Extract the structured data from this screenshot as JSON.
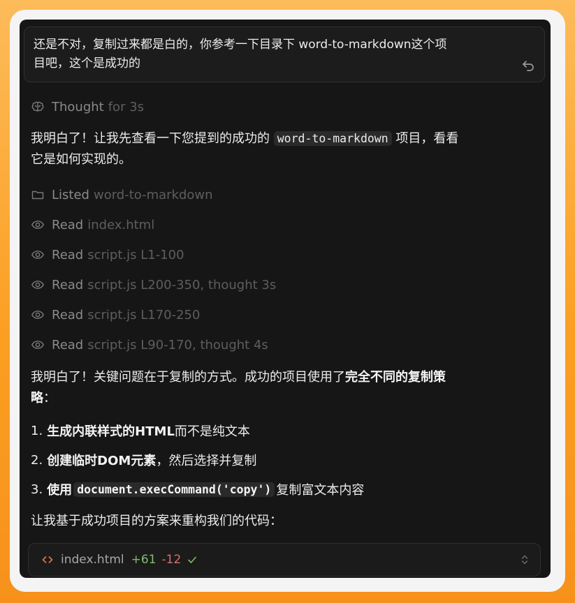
{
  "user_message": {
    "line1": "还是不对，复制过来都是白的，你参考一下目录下 word-to-markdown这个项",
    "line2": "目吧，这个是成功的"
  },
  "thought": {
    "label": "Thought",
    "duration": "for 3s"
  },
  "intro": {
    "before": "我明白了！让我先查看一下您提到的成功的 ",
    "code": "word-to-markdown",
    "after": " 项目，看看",
    "line2": "它是如何实现的。"
  },
  "tool_calls": [
    {
      "verb": "Listed",
      "target": "word-to-markdown",
      "icon": "folder-icon"
    },
    {
      "verb": "Read",
      "target": "index.html",
      "icon": "eye-icon"
    },
    {
      "verb": "Read",
      "target": "script.js L1-100",
      "icon": "eye-icon"
    },
    {
      "verb": "Read",
      "target": "script.js L200-350, thought 3s",
      "icon": "eye-icon"
    },
    {
      "verb": "Read",
      "target": "script.js L170-250",
      "icon": "eye-icon"
    },
    {
      "verb": "Read",
      "target": "script.js L90-170, thought 4s",
      "icon": "eye-icon"
    }
  ],
  "analysis": {
    "text": "我明白了！关键问题在于复制的方式。成功的项目使用了",
    "bold": "完全不同的复制策",
    "bold2": "略",
    "tail": "："
  },
  "steps": [
    {
      "num": "1.",
      "bold": "生成内联样式的HTML",
      "rest": "而不是纯文本"
    },
    {
      "num": "2.",
      "bold": "创建临时DOM元素",
      "rest": "，然后选择并复制"
    },
    {
      "num": "3.",
      "bold": "使用",
      "code": "document.execCommand('copy')",
      "rest": "复制富文本内容"
    }
  ],
  "closing": "让我基于成功项目的方案来重构我们的代码：",
  "file_change": {
    "filename": "index.html",
    "additions": "+61",
    "deletions": "-12"
  },
  "colors": {
    "accent_orange": "#fb9f22",
    "panel_bg": "#161616",
    "additions": "#7fbf6a",
    "deletions": "#d86f6f"
  }
}
